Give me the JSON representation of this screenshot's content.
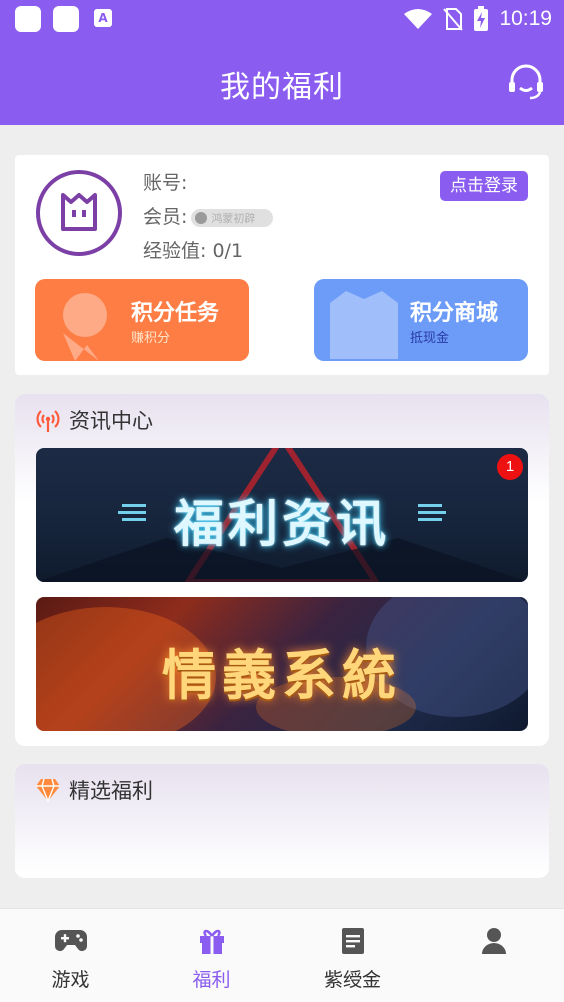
{
  "status_bar": {
    "time": "10:19",
    "icons": [
      "app-square-icon",
      "app-square-icon",
      "a-letter-icon",
      "wifi-icon",
      "no-sim-icon",
      "battery-charging-icon"
    ]
  },
  "header": {
    "title": "我的福利",
    "support_icon": "headset-icon",
    "bg_color": "#8a5cf0"
  },
  "account": {
    "account_label": "账号:",
    "member_label": "会员:",
    "member_badge": "鸿蒙初辟",
    "exp_label": "经验值:",
    "exp_value": "0/1",
    "login_button": "点击登录"
  },
  "points": {
    "task": {
      "title": "积分任务",
      "subtitle": "赚积分",
      "color": "#fd7d45"
    },
    "shop": {
      "title": "积分商城",
      "subtitle": "抵现金",
      "color": "#6c9cf8"
    }
  },
  "news": {
    "title": "资讯中心",
    "icon": "broadcast-icon",
    "banners": [
      {
        "text": "福利资讯",
        "badge": "1"
      },
      {
        "text": "情義系統"
      }
    ]
  },
  "featured": {
    "title": "精选福利",
    "icon": "diamond-icon"
  },
  "bottom_nav": {
    "items": [
      {
        "label": "游戏",
        "icon": "gamepad-icon",
        "active": false
      },
      {
        "label": "福利",
        "icon": "gift-icon",
        "active": true
      },
      {
        "label": "紫绶金",
        "icon": "document-icon",
        "active": false
      },
      {
        "label": "",
        "icon": "person-icon",
        "active": false
      }
    ]
  },
  "accent_color": "#8a5cf0"
}
